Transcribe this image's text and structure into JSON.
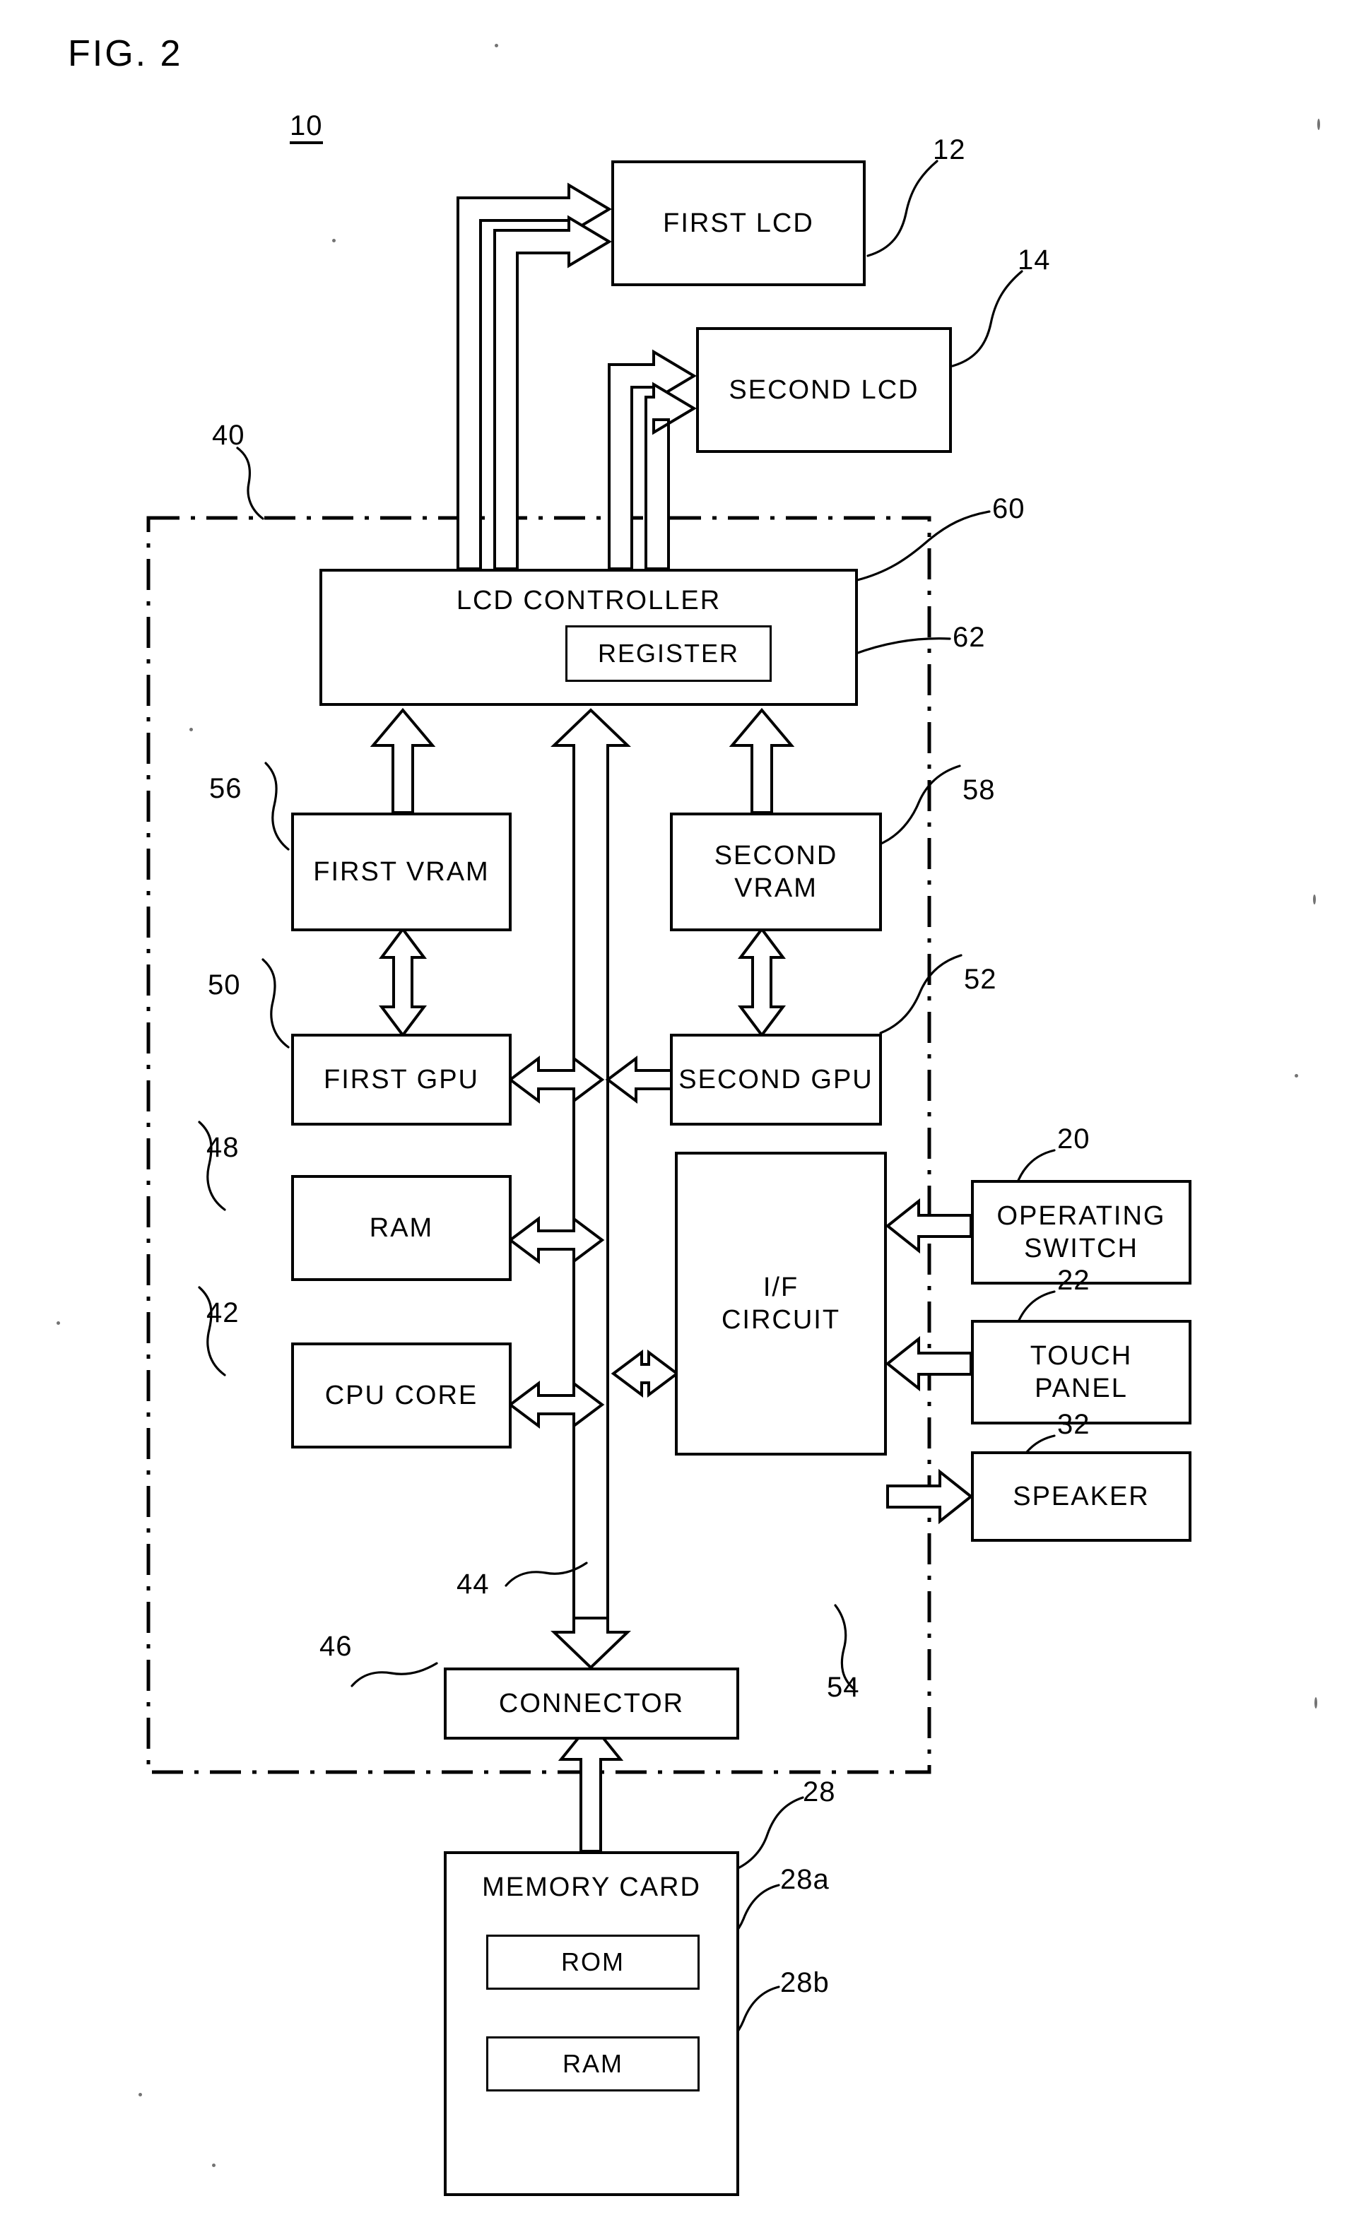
{
  "figure": {
    "title": "FIG. 2",
    "system_ref": "10"
  },
  "blocks": [
    {
      "id": "first_lcd",
      "label": "FIRST LCD",
      "ref": "12"
    },
    {
      "id": "second_lcd",
      "label": "SECOND LCD",
      "ref": "14"
    },
    {
      "id": "lcd_controller",
      "label": "LCD CONTROLLER",
      "ref": "60"
    },
    {
      "id": "register",
      "label": "REGISTER",
      "ref": "62"
    },
    {
      "id": "first_vram",
      "label": "FIRST VRAM",
      "ref": "56"
    },
    {
      "id": "second_vram",
      "label": "SECOND\nVRAM",
      "ref": "58"
    },
    {
      "id": "first_gpu",
      "label": "FIRST GPU",
      "ref": "50"
    },
    {
      "id": "second_gpu",
      "label": "SECOND GPU",
      "ref": "52"
    },
    {
      "id": "ram",
      "label": "RAM",
      "ref": "48"
    },
    {
      "id": "cpu_core",
      "label": "CPU CORE",
      "ref": "42"
    },
    {
      "id": "if_circuit",
      "label": "I/F\nCIRCUIT",
      "ref": "54"
    },
    {
      "id": "operating_switch",
      "label": "OPERATING\nSWITCH",
      "ref": "20"
    },
    {
      "id": "touch_panel",
      "label": "TOUCH\nPANEL",
      "ref": "22"
    },
    {
      "id": "speaker",
      "label": "SPEAKER",
      "ref": "32"
    },
    {
      "id": "connector",
      "label": "CONNECTOR",
      "ref": "46"
    },
    {
      "id": "memory_card",
      "label": "MEMORY CARD",
      "ref": "28"
    },
    {
      "id": "card_rom",
      "label": "ROM",
      "ref": "28a"
    },
    {
      "id": "card_ram",
      "label": "RAM",
      "ref": "28b"
    }
  ],
  "labels": {
    "first_lcd": "FIRST LCD",
    "second_lcd": "SECOND LCD",
    "lcd_controller": "LCD CONTROLLER",
    "register": "REGISTER",
    "first_vram": "FIRST VRAM",
    "second_vram_line1": "SECOND",
    "second_vram_line2": "VRAM",
    "first_gpu": "FIRST GPU",
    "second_gpu": "SECOND GPU",
    "ram": "RAM",
    "cpu_core": "CPU CORE",
    "if_circuit_line1": "I/F",
    "if_circuit_line2": "CIRCUIT",
    "operating_switch_line1": "OPERATING",
    "operating_switch_line2": "SWITCH",
    "touch_panel_line1": "TOUCH",
    "touch_panel_line2": "PANEL",
    "speaker": "SPEAKER",
    "connector": "CONNECTOR",
    "memory_card": "MEMORY CARD",
    "card_rom": "ROM",
    "card_ram": "RAM"
  },
  "refs": {
    "system": "10",
    "first_lcd": "12",
    "second_lcd": "14",
    "operating_switch": "20",
    "touch_panel": "22",
    "memory_card": "28",
    "card_rom": "28a",
    "card_ram": "28b",
    "speaker": "32",
    "electronic_circuit_board": "40",
    "cpu_core": "42",
    "bus": "44",
    "connector": "46",
    "ram": "48",
    "first_gpu": "50",
    "second_gpu": "52",
    "if_circuit": "54",
    "first_vram": "56",
    "second_vram": "58",
    "lcd_controller": "60",
    "register": "62"
  },
  "colors": {
    "stroke": "#000000",
    "background": "#ffffff"
  }
}
